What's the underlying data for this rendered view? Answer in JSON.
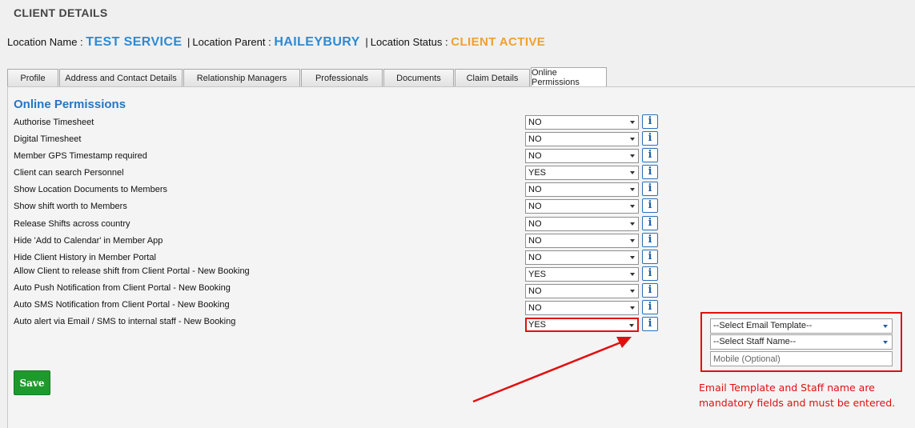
{
  "header": {
    "title": "CLIENT DETAILS",
    "location_name_label": "Location Name :",
    "location_name": "TEST SERVICE",
    "location_parent_label": "Location Parent :",
    "location_parent": "HAILEYBURY",
    "location_status_label": "Location Status :",
    "location_status": "CLIENT ACTIVE",
    "separator": "|"
  },
  "tabs": [
    {
      "label": "Profile",
      "active": false
    },
    {
      "label": "Address and Contact Details",
      "active": false
    },
    {
      "label": "Relationship Managers",
      "active": false
    },
    {
      "label": "Professionals",
      "active": false
    },
    {
      "label": "Documents",
      "active": false
    },
    {
      "label": "Claim Details",
      "active": false
    },
    {
      "label": "Online Permissions",
      "active": true
    }
  ],
  "section_title": "Online Permissions",
  "permissions": [
    {
      "label": "Authorise Timesheet",
      "value": "NO"
    },
    {
      "label": "Digital Timesheet",
      "value": "NO"
    },
    {
      "label": "Member GPS Timestamp required",
      "value": "NO"
    },
    {
      "label": "Client can search Personnel",
      "value": "YES"
    },
    {
      "label": "Show Location Documents to Members",
      "value": "NO"
    },
    {
      "label": "Show shift worth to Members",
      "value": "NO"
    },
    {
      "label": "Release Shifts across country",
      "value": "NO"
    },
    {
      "label": "Hide 'Add to Calendar' in Member App",
      "value": "NO"
    },
    {
      "label": "Hide Client History in Member Portal",
      "value": "NO"
    },
    {
      "label": "Allow Client to release shift from Client Portal - New Booking",
      "value": "YES"
    },
    {
      "label": "Auto Push Notification from Client Portal - New Booking",
      "value": "NO"
    },
    {
      "label": "Auto SMS Notification from Client Portal - New Booking",
      "value": "NO"
    },
    {
      "label": "Auto alert via Email / SMS to internal staff - New Booking",
      "value": "YES"
    }
  ],
  "info_icon_glyph": "i",
  "alert_options": {
    "email_template": "--Select Email Template--",
    "staff_name": "--Select Staff Name--",
    "mobile_placeholder": "Mobile (Optional)"
  },
  "save_label": "Save",
  "annotation": {
    "note_line1": "Email Template and Staff name are",
    "note_line2": "mandatory fields and must be entered.",
    "color": "#e01010"
  },
  "colors": {
    "accent_blue": "#2d8ad3",
    "status_orange": "#f0a030",
    "section_blue": "#2776c0",
    "save_green": "#1e9a2c"
  }
}
